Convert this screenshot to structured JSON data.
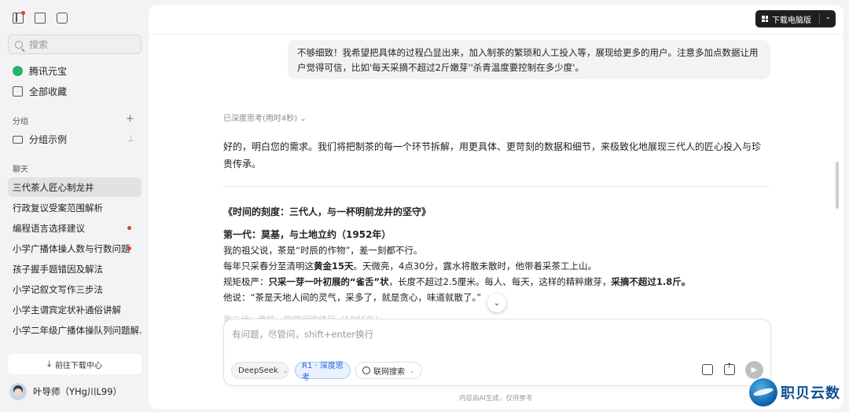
{
  "sidebar": {
    "search_placeholder": "搜索",
    "nav": [
      {
        "label": "腾讯元宝",
        "icon": "yuanbao-logo-icon"
      },
      {
        "label": "全部收藏",
        "icon": "bookmark-icon"
      }
    ],
    "groups_label": "分组",
    "group_items": [
      {
        "label": "分组示例",
        "icon": "folder-icon"
      }
    ],
    "chats_label": "聊天",
    "chats": [
      {
        "label": "三代茶人匠心制龙井",
        "active": true,
        "unread": false
      },
      {
        "label": "行政复议受案范围解析",
        "active": false,
        "unread": false
      },
      {
        "label": "编程语言选择建议",
        "active": false,
        "unread": true
      },
      {
        "label": "小学广播体操人数与行数问题",
        "active": false,
        "unread": true
      },
      {
        "label": "孩子握手题错因及解法",
        "active": false,
        "unread": false
      },
      {
        "label": "小学记叙文写作三步法",
        "active": false,
        "unread": false
      },
      {
        "label": "小学主谓宾定状补通俗讲解",
        "active": false,
        "unread": false
      },
      {
        "label": "小学二年级广播体操队列问题解...",
        "active": false,
        "unread": false
      }
    ],
    "download_center": "前往下载中心",
    "user_name": "叶导师（YHg川L99）"
  },
  "header": {
    "download_pc": "下载电脑版"
  },
  "conversation": {
    "user_message": "不够细致！我希望把具体的过程凸显出来，加入制茶的繁琐和人工投入等，展现给更多的用户。注意多加点数据让用户觉得可信，比如'每天采摘不超过2斤嫩芽''杀青温度要控制在多少度'。",
    "thinking_status": "已深度思考(用时4秒)",
    "answer_intro": "好的，明白您的需求。我们将把制茶的每一个环节拆解，用更具体、更苛刻的数据和细节，来极致化地展现三代人的匠心投入与珍贵传承。",
    "article_title": "《时间的刻度：三代人，与一杯明前龙井的坚守》",
    "section1_title": "第一代：莫基，与土地立约（1952年）",
    "p1": "我的祖父说，茶是“时辰的作物”，差一刻都不行。",
    "p2_a": "每年只采春分至清明这",
    "p2_b": "黄金15天",
    "p2_c": "。天微亮，4点30分，露水将散未散时，他带着采茶工上山。",
    "p3_a": "规矩极严：",
    "p3_b": "只采一芽一叶初展的“雀舌”状",
    "p3_c": "，长度不超过2.5厘米。每人、每天，这样的精粹嫩芽，",
    "p3_d": "采摘不超过1.8斤。",
    "p4": "他说：“茶是天地人间的灵气，采多了，就是贪心，味道就散了。”",
    "faded_next": "第二代：传技，指掌间的修行（1985年）"
  },
  "composer": {
    "placeholder": "有问题，尽管问，shift+enter换行",
    "model_chip": "DeepSeek",
    "mode_chip": "R1 · 深度思考",
    "web_chip": "联网搜索",
    "footnote": "内容由AI生成，仅供参考"
  },
  "watermark": {
    "text": "职贝云数"
  }
}
